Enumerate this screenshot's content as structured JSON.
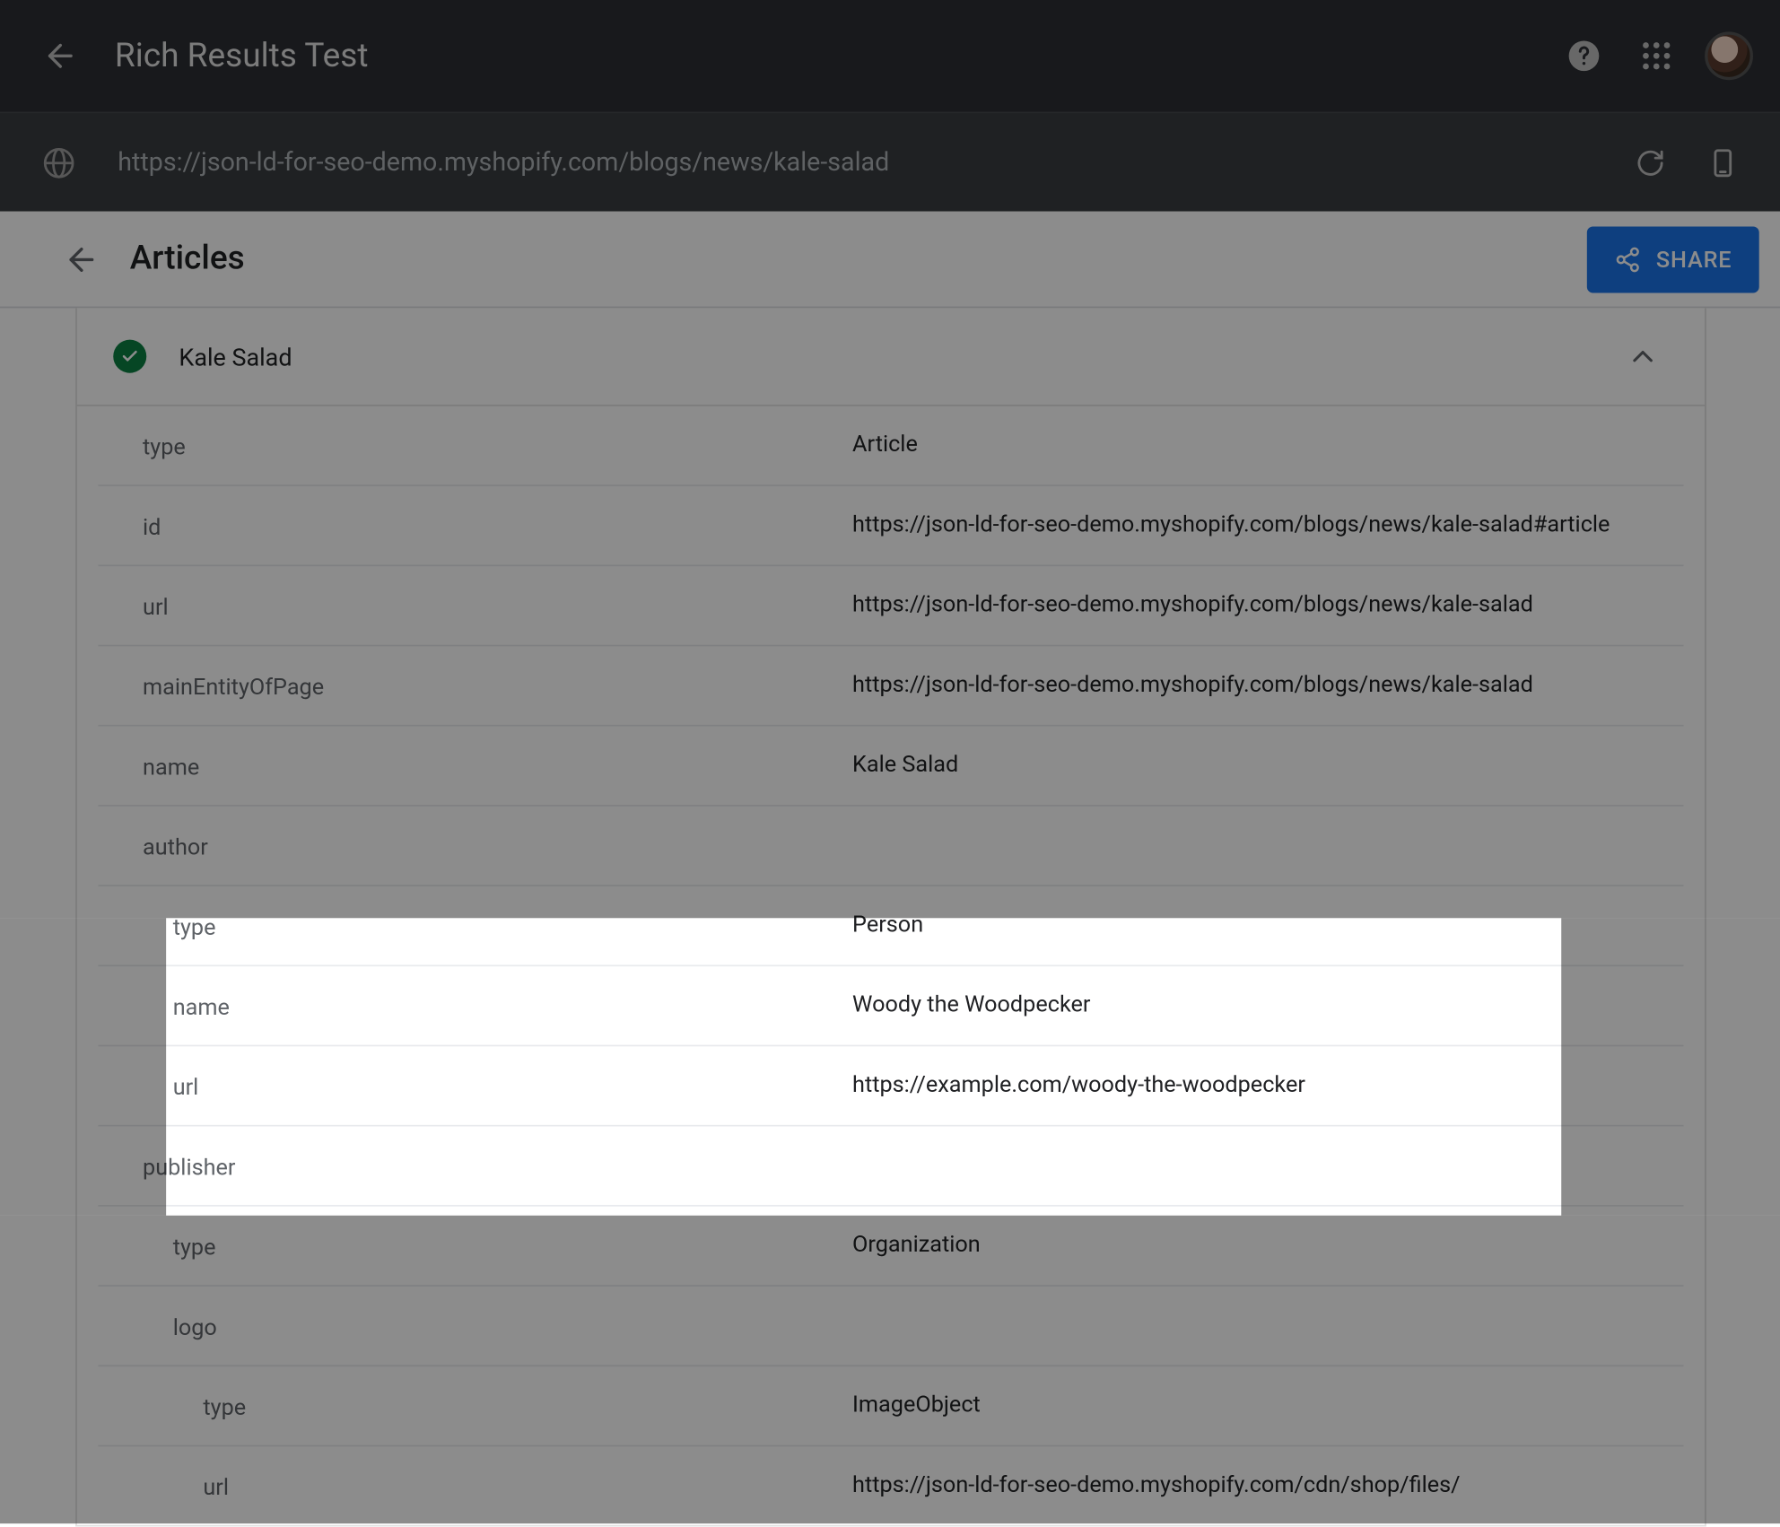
{
  "topbar": {
    "title": "Rich Results Test"
  },
  "urlbar": {
    "url": "https://json-ld-for-seo-demo.myshopify.com/blogs/news/kale-salad"
  },
  "section": {
    "title": "Articles",
    "share_label": "SHARE"
  },
  "item": {
    "name": "Kale Salad"
  },
  "rows": [
    {
      "key": "type",
      "val": "Article",
      "indent": 0
    },
    {
      "key": "id",
      "val": "https://json-ld-for-seo-demo.myshopify.com/blogs/news/kale-salad#article",
      "indent": 0
    },
    {
      "key": "url",
      "val": "https://json-ld-for-seo-demo.myshopify.com/blogs/news/kale-salad",
      "indent": 0
    },
    {
      "key": "mainEntityOfPage",
      "val": "https://json-ld-for-seo-demo.myshopify.com/blogs/news/kale-salad",
      "indent": 0
    },
    {
      "key": "name",
      "val": "Kale Salad",
      "indent": 0
    },
    {
      "key": "author",
      "val": "",
      "indent": 0
    },
    {
      "key": "type",
      "val": "Person",
      "indent": 1
    },
    {
      "key": "name",
      "val": "Woody the Woodpecker",
      "indent": 1
    },
    {
      "key": "url",
      "val": "https://example.com/woody-the-woodpecker",
      "indent": 1
    },
    {
      "key": "publisher",
      "val": "",
      "indent": 0
    },
    {
      "key": "type",
      "val": "Organization",
      "indent": 1
    },
    {
      "key": "logo",
      "val": "",
      "indent": 1
    },
    {
      "key": "type",
      "val": "ImageObject",
      "indent": 2
    },
    {
      "key": "url",
      "val": "https://json-ld-for-seo-demo.myshopify.com/cdn/shop/files/",
      "indent": 2
    }
  ]
}
